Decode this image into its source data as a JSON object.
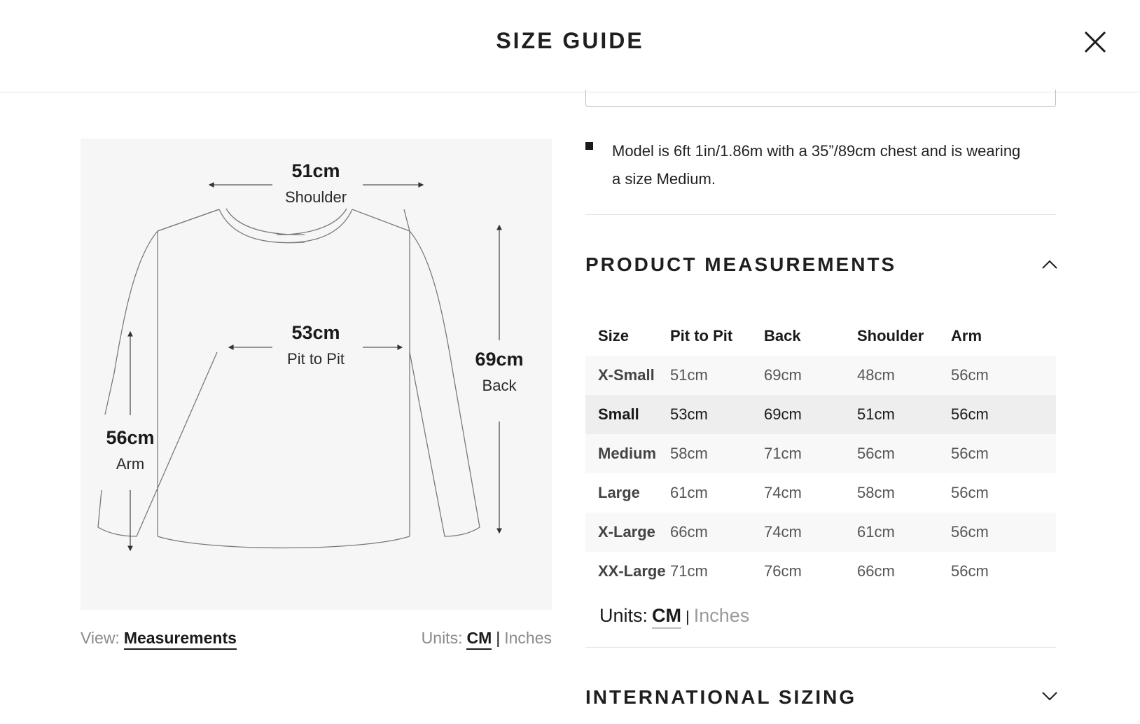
{
  "header": {
    "title": "SIZE GUIDE"
  },
  "figure": {
    "shoulder": {
      "value": "51cm",
      "label": "Shoulder"
    },
    "pit": {
      "value": "53cm",
      "label": "Pit to Pit"
    },
    "back": {
      "value": "69cm",
      "label": "Back"
    },
    "arm": {
      "value": "56cm",
      "label": "Arm"
    }
  },
  "view": {
    "label": "View:",
    "active": "Measurements"
  },
  "units": {
    "label": "Units:",
    "active": "CM",
    "separator": "|",
    "inactive": "Inches"
  },
  "model_note": "Model is 6ft 1in/1.86m with a 35”/89cm chest and is wearing a size Medium.",
  "measurements": {
    "title": "PRODUCT MEASUREMENTS",
    "headers": [
      "Size",
      "Pit to Pit",
      "Back",
      "Shoulder",
      "Arm"
    ],
    "rows": [
      [
        "X-Small",
        "51cm",
        "69cm",
        "48cm",
        "56cm"
      ],
      [
        "Small",
        "53cm",
        "69cm",
        "51cm",
        "56cm"
      ],
      [
        "Medium",
        "58cm",
        "71cm",
        "56cm",
        "56cm"
      ],
      [
        "Large",
        "61cm",
        "74cm",
        "58cm",
        "56cm"
      ],
      [
        "X-Large",
        "66cm",
        "74cm",
        "61cm",
        "56cm"
      ],
      [
        "XX-Large",
        "71cm",
        "76cm",
        "66cm",
        "56cm"
      ]
    ],
    "selected_size": "Small",
    "units": {
      "label": "Units:",
      "active": "CM",
      "separator": "|",
      "inactive": "Inches"
    }
  },
  "international": {
    "title": "INTERNATIONAL SIZING"
  }
}
